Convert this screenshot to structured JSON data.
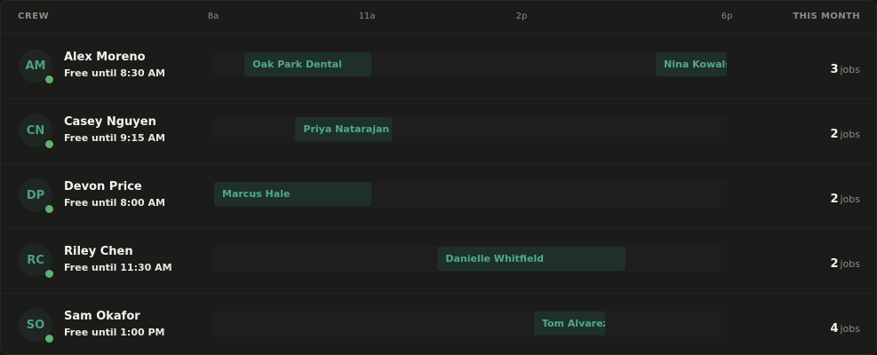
{
  "header": {
    "crew_label": "CREW",
    "month_label": "THIS MONTH",
    "ticks": [
      "8a",
      "11a",
      "2p",
      "6p"
    ]
  },
  "count_unit": "jobs",
  "crew": [
    {
      "initials": "AM",
      "name": "Alex Moreno",
      "status": "Free until 8:30 AM",
      "jobs_count": "3",
      "jobs": [
        {
          "label": "Oak Park Dental",
          "start": 8.5,
          "end": 11.0
        },
        {
          "label": "Nina Kowalski",
          "start": 16.6,
          "end": 18.1
        }
      ]
    },
    {
      "initials": "CN",
      "name": "Casey Nguyen",
      "status": "Free until 9:15 AM",
      "jobs_count": "2",
      "jobs": [
        {
          "label": "Priya Natarajan",
          "start": 9.5,
          "end": 11.4
        }
      ]
    },
    {
      "initials": "DP",
      "name": "Devon Price",
      "status": "Free until 8:00 AM",
      "jobs_count": "2",
      "jobs": [
        {
          "label": "Marcus Hale",
          "start": 7.9,
          "end": 11.0
        }
      ]
    },
    {
      "initials": "RC",
      "name": "Riley Chen",
      "status": "Free until 11:30 AM",
      "jobs_count": "2",
      "jobs": [
        {
          "label": "Danielle Whitfield",
          "start": 12.3,
          "end": 16.0
        }
      ]
    },
    {
      "initials": "SO",
      "name": "Sam Okafor",
      "status": "Free until 1:00 PM",
      "jobs_count": "4",
      "jobs": [
        {
          "label": "Tom Alvarez",
          "start": 14.2,
          "end": 15.6
        }
      ]
    }
  ],
  "colors": {
    "accent": "#4fa88c",
    "status_dot": "#62b16b",
    "job_bg": "#1f302a",
    "panel_bg": "#1b1b19"
  }
}
